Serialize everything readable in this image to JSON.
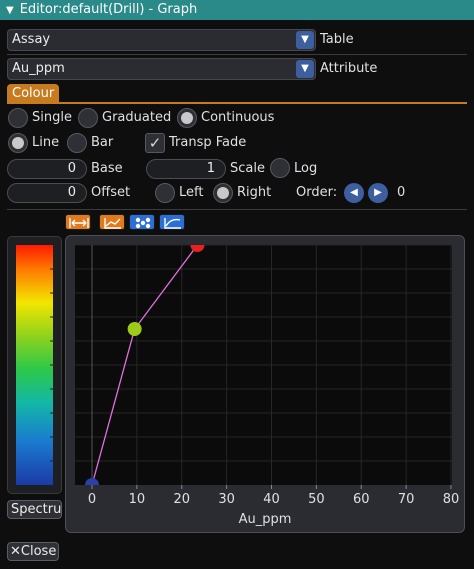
{
  "window": {
    "title": "Editor:default(Drill) - Graph"
  },
  "table": {
    "value": "Assay",
    "label": "Table"
  },
  "attribute": {
    "value": "Au_ppm",
    "label": "Attribute"
  },
  "tabs": [
    {
      "label": "Colour"
    }
  ],
  "mode": {
    "options": [
      "Single",
      "Graduated",
      "Continuous"
    ],
    "selected": "Continuous"
  },
  "style": {
    "options": [
      "Line",
      "Bar"
    ],
    "selected": "Line",
    "transp_fade_label": "Transp Fade",
    "transp_fade_checked": true
  },
  "base": {
    "value": "0",
    "label": "Base"
  },
  "scale": {
    "value": "1",
    "label": "Scale"
  },
  "log": {
    "label": "Log",
    "checked": false
  },
  "offset": {
    "value": "0",
    "label": "Offset"
  },
  "side": {
    "options": [
      "Left",
      "Right"
    ],
    "selected": "Right"
  },
  "order": {
    "label": "Order:",
    "value": "0"
  },
  "toolbar": {
    "icons": [
      {
        "name": "fit-horizontal-icon",
        "color": "#e07a1a"
      },
      {
        "name": "line-graph-icon",
        "color": "#e07a1a"
      },
      {
        "name": "points-icon",
        "color": "#2b6fd6"
      },
      {
        "name": "curve-icon",
        "color": "#2b6fd6"
      }
    ]
  },
  "colormap": {
    "label": "Spectrum"
  },
  "close_button": {
    "label": "Close"
  },
  "chart_data": {
    "type": "line",
    "title": "",
    "xlabel": "Au_ppm",
    "ylabel": "",
    "xlim": [
      0,
      80
    ],
    "ylim": [
      0,
      1
    ],
    "xticks": [
      0,
      10,
      20,
      30,
      40,
      50,
      60,
      70,
      80
    ],
    "grid": true,
    "series": [
      {
        "x": [
          0,
          9.5,
          23.5
        ],
        "y": [
          0,
          0.65,
          1.0
        ],
        "line_color": "#e070e0",
        "point_colors": [
          "#2a3fa8",
          "#9ccc18",
          "#e82020"
        ]
      }
    ]
  }
}
